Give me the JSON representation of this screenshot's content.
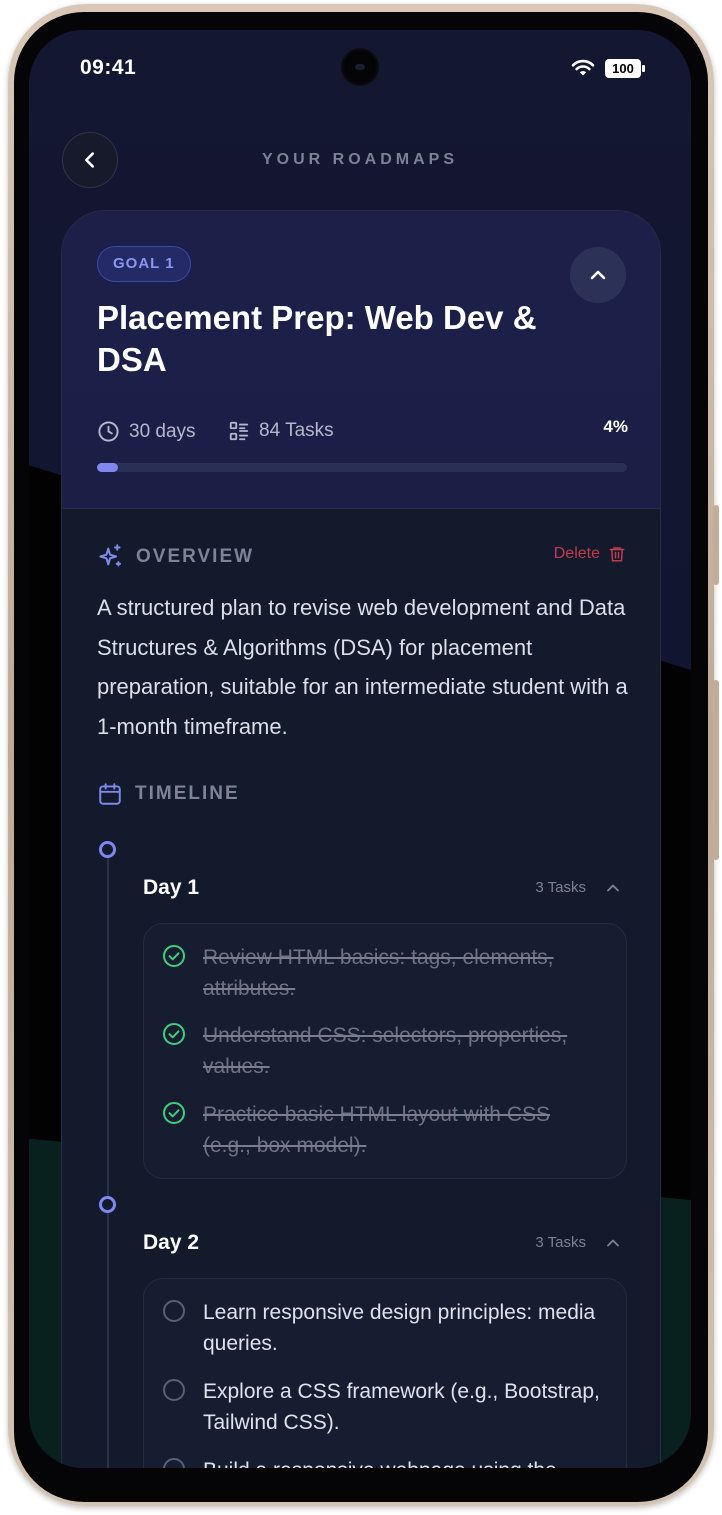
{
  "status_bar": {
    "time": "09:41",
    "battery": "100",
    "icons": [
      "wifi-icon",
      "battery-icon"
    ]
  },
  "header": {
    "title": "YOUR ROADMAPS",
    "back_icon": "chevron-left-icon"
  },
  "goal": {
    "badge": "GOAL 1",
    "title": "Placement Prep: Web Dev & DSA",
    "duration": "30 days",
    "tasks_count": "84 Tasks",
    "progress_label": "4%",
    "progress_value": 0.04,
    "collapse_icon": "chevron-up-icon"
  },
  "overview": {
    "label": "OVERVIEW",
    "delete_label": "Delete",
    "text": "A structured plan to revise web development and Data Structures & Algorithms (DSA) for placement preparation, suitable for an intermediate student with a 1-month timeframe."
  },
  "timeline": {
    "label": "TIMELINE",
    "days": [
      {
        "label": "Day 1",
        "count": "3 Tasks",
        "tasks": [
          {
            "text": "Review HTML basics: tags, elements, attributes.",
            "done": true
          },
          {
            "text": "Understand CSS: selectors, properties, values.",
            "done": true
          },
          {
            "text": "Practice basic HTML layout with CSS (e.g., box model).",
            "done": true
          }
        ]
      },
      {
        "label": "Day 2",
        "count": "3 Tasks",
        "tasks": [
          {
            "text": "Learn responsive design principles: media queries.",
            "done": false
          },
          {
            "text": "Explore a CSS framework (e.g., Bootstrap, Tailwind CSS).",
            "done": false
          },
          {
            "text": "Build a responsive webpage using the",
            "done": false
          }
        ]
      }
    ]
  },
  "colors": {
    "accent": "#8088f0",
    "done_check": "#3fcf7a",
    "delete": "#c23b4d",
    "background": "#121a2c"
  }
}
